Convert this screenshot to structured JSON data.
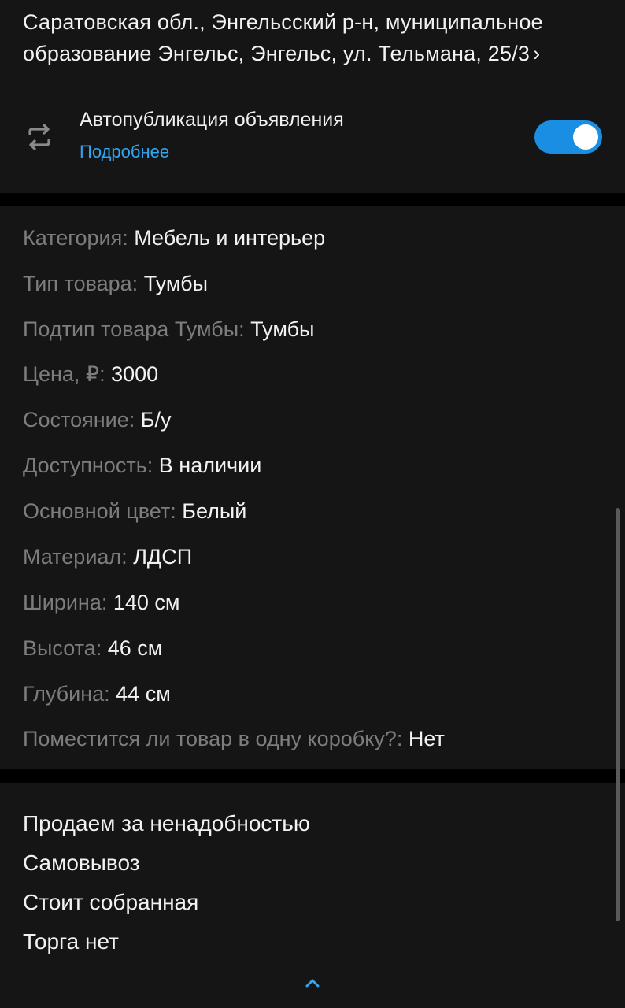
{
  "address": {
    "text": "Саратовская обл., Энгельсский р-н, муниципальное образование Энгельс, Энгельс, ул. Тельмана, 25/3",
    "chevron": "›"
  },
  "autopublish": {
    "title": "Автопубликация объявления",
    "link": "Подробнее",
    "enabled": true,
    "icon": "repeat-icon"
  },
  "specs": [
    {
      "label": "Категория:",
      "value": "Мебель и интерьер"
    },
    {
      "label": "Тип товара:",
      "value": "Тумбы"
    },
    {
      "label": "Подтип товара Тумбы:",
      "value": "Тумбы"
    },
    {
      "label": "Цена, ₽:",
      "value": "3000"
    },
    {
      "label": "Состояние:",
      "value": "Б/у"
    },
    {
      "label": "Доступность:",
      "value": "В наличии"
    },
    {
      "label": "Основной цвет:",
      "value": "Белый"
    },
    {
      "label": "Материал:",
      "value": "ЛДСП"
    },
    {
      "label": "Ширина:",
      "value": "140 см"
    },
    {
      "label": "Высота:",
      "value": "46 см"
    },
    {
      "label": "Глубина:",
      "value": "44 см"
    },
    {
      "label": "Поместится ли товар в одну коробку?:",
      "value": "Нет"
    }
  ],
  "description": [
    "Продаем за ненадобностью",
    "Самовывоз",
    "Стоит собранная",
    "Торга нет"
  ],
  "colors": {
    "accent": "#1a8ee3",
    "link": "#2ea7f5",
    "background": "#151515",
    "label": "#7d7d7d"
  }
}
